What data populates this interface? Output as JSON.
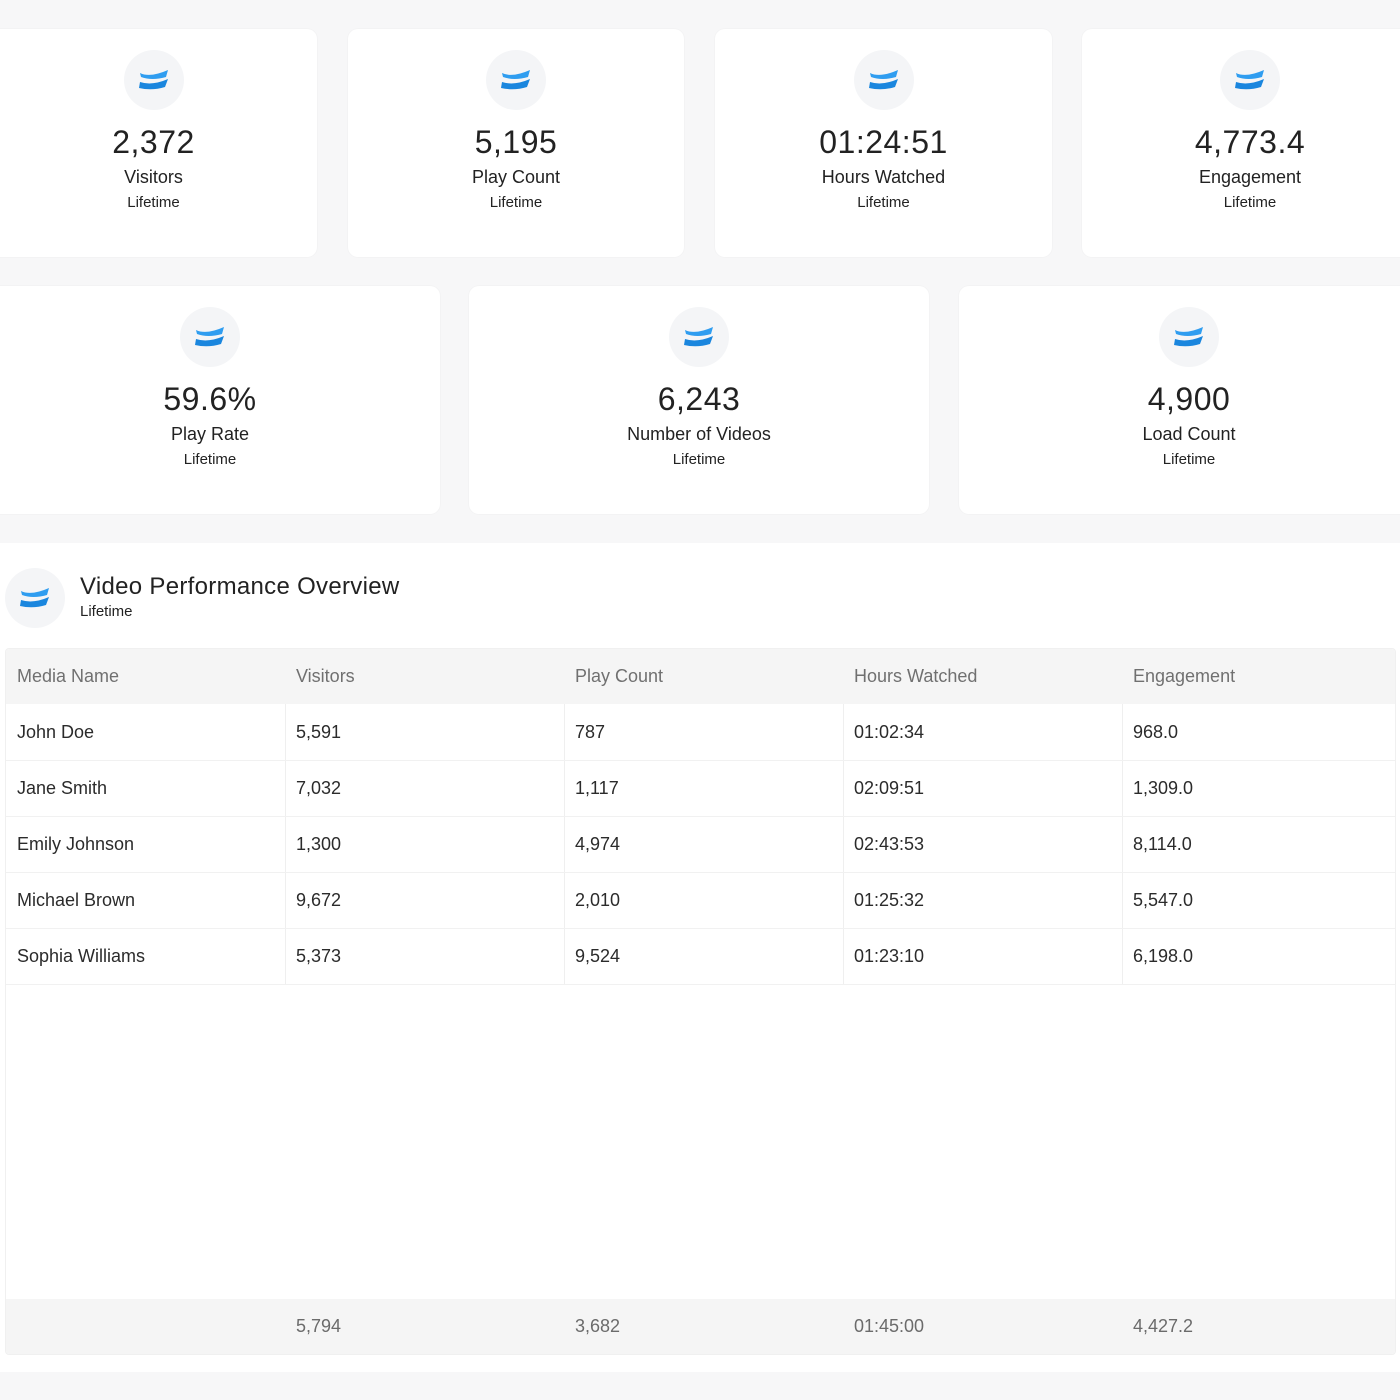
{
  "brand": {
    "accent": "#2f9df0",
    "accent_dark": "#1a86de",
    "icon": "wistia-logo-icon"
  },
  "stats_row1": [
    {
      "value": "2,372",
      "label": "Visitors",
      "period": "Lifetime"
    },
    {
      "value": "5,195",
      "label": "Play Count",
      "period": "Lifetime"
    },
    {
      "value": "01:24:51",
      "label": "Hours Watched",
      "period": "Lifetime"
    },
    {
      "value": "4,773.4",
      "label": "Engagement",
      "period": "Lifetime"
    }
  ],
  "stats_row2": [
    {
      "value": "59.6%",
      "label": "Play Rate",
      "period": "Lifetime"
    },
    {
      "value": "6,243",
      "label": "Number of Videos",
      "period": "Lifetime"
    },
    {
      "value": "4,900",
      "label": "Load Count",
      "period": "Lifetime"
    }
  ],
  "overview": {
    "title": "Video Performance Overview",
    "period": "Lifetime",
    "columns": [
      "Media Name",
      "Visitors",
      "Play Count",
      "Hours Watched",
      "Engagement"
    ],
    "rows": [
      [
        "John Doe",
        "5,591",
        "787",
        "01:02:34",
        "968.0"
      ],
      [
        "Jane Smith",
        "7,032",
        "1,117",
        "02:09:51",
        "1,309.0"
      ],
      [
        "Emily Johnson",
        "1,300",
        "4,974",
        "02:43:53",
        "8,114.0"
      ],
      [
        "Michael Brown",
        "9,672",
        "2,010",
        "01:25:32",
        "5,547.0"
      ],
      [
        "Sophia Williams",
        "5,373",
        "9,524",
        "01:23:10",
        "6,198.0"
      ]
    ],
    "totals": [
      "",
      "5,794",
      "3,682",
      "01:45:00",
      "4,427.2"
    ]
  }
}
